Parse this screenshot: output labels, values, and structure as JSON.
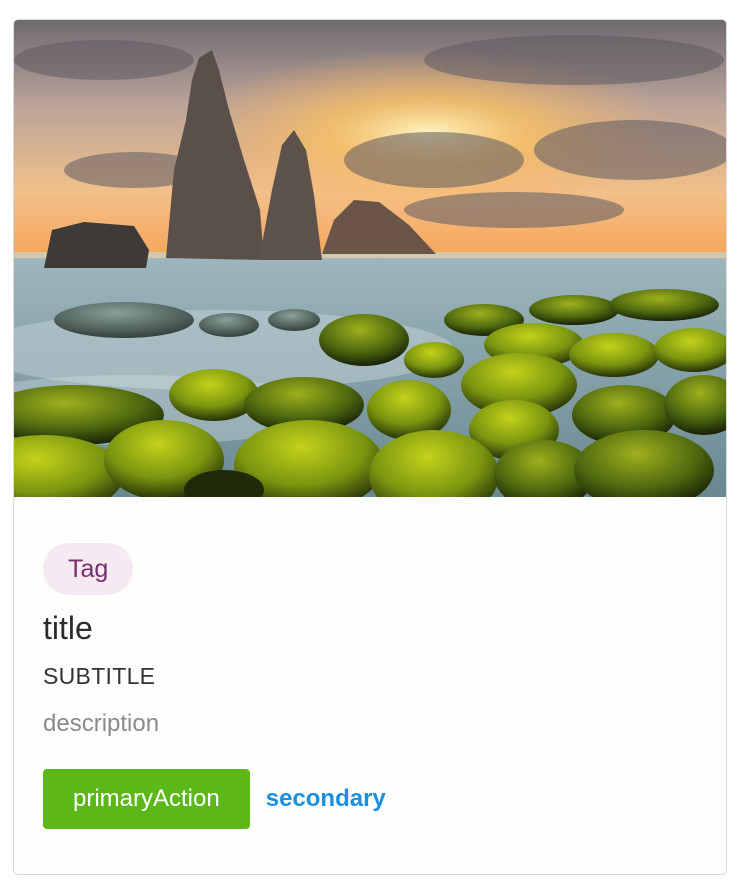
{
  "card": {
    "image_description": "",
    "tag": "Tag",
    "title": "title",
    "subtitle": "SUBTITLE",
    "description": "description",
    "primary_action": "primaryAction",
    "secondary_action": "secondary"
  },
  "colors": {
    "tag_bg": "#f5e9f2",
    "tag_text": "#74306a",
    "primary_button": "#5cb818",
    "secondary_link": "#1a8fe0"
  }
}
